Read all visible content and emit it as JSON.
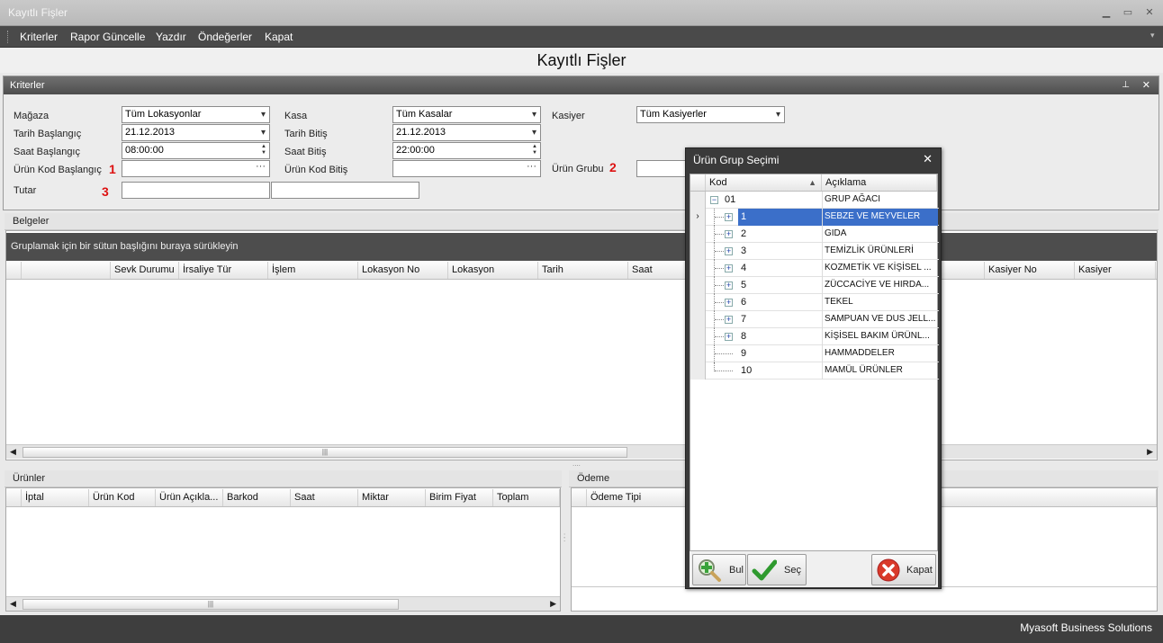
{
  "window": {
    "title": "Kayıtlı Fişler",
    "min": "▁",
    "max": "▭",
    "close": "✕"
  },
  "menu": {
    "items": [
      "Kriterler",
      "Rapor Güncelle",
      "Yazdır",
      "Öndeğerler",
      "Kapat"
    ],
    "overflow": "▾"
  },
  "page_title": "Kayıtlı Fişler",
  "kriterler": {
    "header": "Kriterler",
    "pin": "⊥",
    "close": "✕",
    "magaza_label": "Mağaza",
    "magaza_value": "Tüm Lokasyonlar",
    "kasa_label": "Kasa",
    "kasa_value": "Tüm Kasalar",
    "kasiyer_label": "Kasiyer",
    "kasiyer_value": "Tüm Kasiyerler",
    "tarih_bas_label": "Tarih Başlangıç",
    "tarih_bas_value": "21.12.2013",
    "tarih_bit_label": "Tarih Bitiş",
    "tarih_bit_value": "21.12.2013",
    "saat_bas_label": "Saat Başlangıç",
    "saat_bas_value": "08:00:00",
    "saat_bit_label": "Saat Bitiş",
    "saat_bit_value": "22:00:00",
    "urun_kod_bas_label": "Ürün Kod Başlangıç",
    "urun_kod_bas_value": "",
    "urun_kod_bit_label": "Ürün Kod Bitiş",
    "urun_kod_bit_value": "",
    "urun_grubu_label": "Ürün Grubu",
    "urun_grubu_value": "",
    "tutar_label": "Tutar",
    "tutar_min": "",
    "tutar_max": "",
    "marker1": "1",
    "marker2": "2",
    "marker3": "3",
    "ellipsis": "···"
  },
  "belgeler": {
    "header": "Belgeler",
    "group_hint": "Gruplamak için bir sütun başlığını buraya sürükleyin",
    "columns": [
      "",
      "",
      "Sevk Durumu",
      "İrsaliye Tür",
      "İşlem",
      "Lokasyon No",
      "Lokasyon",
      "Tarih",
      "Saat",
      "Kasiyer No",
      "Kasiyer"
    ]
  },
  "urunler": {
    "header": "Ürünler",
    "columns": [
      "",
      "İptal",
      "Ürün Kod",
      "Ürün Açıkla...",
      "Barkod",
      "Saat",
      "Miktar",
      "Birim Fiyat",
      "Toplam"
    ]
  },
  "odeme": {
    "header": "Ödeme",
    "columns": [
      "",
      "Ödeme Tipi"
    ]
  },
  "dialog": {
    "title": "Ürün Grup Seçimi",
    "close": "✕",
    "col_kod": "Kod",
    "col_aciklama": "Açıklama",
    "sort": "▲",
    "rows": [
      {
        "kod": "01",
        "aciklama": "GRUP AĞACI"
      },
      {
        "kod": "1",
        "aciklama": "SEBZE VE MEYVELER"
      },
      {
        "kod": "2",
        "aciklama": "GIDA"
      },
      {
        "kod": "3",
        "aciklama": "TEMİZLİK ÜRÜNLERİ"
      },
      {
        "kod": "4",
        "aciklama": "KOZMETİK VE KİŞİSEL ..."
      },
      {
        "kod": "5",
        "aciklama": "ZÜCCACİYE VE HIRDA..."
      },
      {
        "kod": "6",
        "aciklama": "TEKEL"
      },
      {
        "kod": "7",
        "aciklama": "SAMPUAN VE DUS JELL..."
      },
      {
        "kod": "8",
        "aciklama": "KİŞİSEL BAKIM ÜRÜNL..."
      },
      {
        "kod": "9",
        "aciklama": "HAMMADDELER"
      },
      {
        "kod": "10",
        "aciklama": "MAMÜL ÜRÜNLER"
      }
    ],
    "selected_index": 1,
    "row_indicator": "›",
    "btn_bul": "Bul",
    "btn_sec": "Seç",
    "btn_kapat": "Kapat"
  },
  "status": {
    "text": "Myasoft Business Solutions"
  },
  "colors": {
    "accent_selection": "#3b6fc9",
    "marker_red": "#d11111"
  }
}
